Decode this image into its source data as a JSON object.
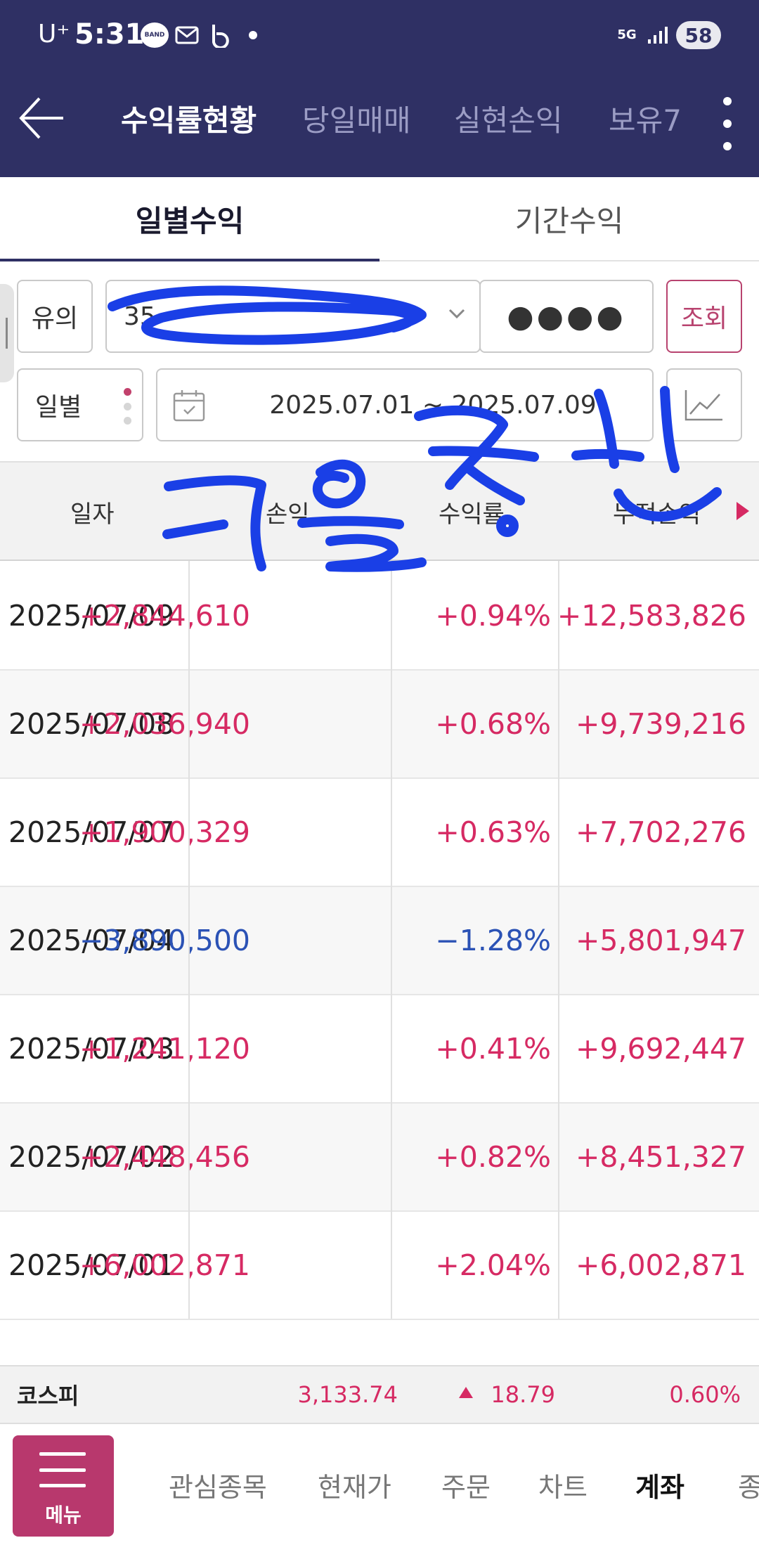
{
  "status_bar": {
    "carrier": "U⁺",
    "time": "5:31",
    "band_label": "BAND",
    "network": "5G",
    "battery": "58"
  },
  "header": {
    "tabs": [
      "수익률현황",
      "당일매매",
      "실현손익",
      "보유7"
    ],
    "active_tab": 0
  },
  "subtabs": [
    "일별수익",
    "기간수익"
  ],
  "controls": {
    "account_type": "유의",
    "account_number": "35",
    "password_mask": "●●●●",
    "query_label": "조회",
    "period_type": "일별",
    "date_range": "2025.07.01 ~ 2025.07.09"
  },
  "table": {
    "headers": [
      "일자",
      "손익",
      "수익률",
      "누적손익"
    ],
    "rows": [
      {
        "date": "2025/07/09",
        "pl": "+2,844,610",
        "rate": "+0.94%",
        "cum": "+12,583,826",
        "pl_sign": "pos",
        "rate_sign": "pos"
      },
      {
        "date": "2025/07/08",
        "pl": "+2,036,940",
        "rate": "+0.68%",
        "cum": "+9,739,216",
        "pl_sign": "pos",
        "rate_sign": "pos"
      },
      {
        "date": "2025/07/07",
        "pl": "+1,900,329",
        "rate": "+0.63%",
        "cum": "+7,702,276",
        "pl_sign": "pos",
        "rate_sign": "pos"
      },
      {
        "date": "2025/07/04",
        "pl": "−3,890,500",
        "rate": "−1.28%",
        "cum": "+5,801,947",
        "pl_sign": "neg",
        "rate_sign": "neg"
      },
      {
        "date": "2025/07/03",
        "pl": "+1,241,120",
        "rate": "+0.41%",
        "cum": "+9,692,447",
        "pl_sign": "pos",
        "rate_sign": "pos"
      },
      {
        "date": "2025/07/02",
        "pl": "+2,448,456",
        "rate": "+0.82%",
        "cum": "+8,451,327",
        "pl_sign": "pos",
        "rate_sign": "pos"
      },
      {
        "date": "2025/07/01",
        "pl": "+6,002,871",
        "rate": "+2.04%",
        "cum": "+6,002,871",
        "pl_sign": "pos",
        "rate_sign": "pos"
      }
    ]
  },
  "kospi": {
    "name": "코스피",
    "value": "3,133.74",
    "change": "18.79",
    "change_pct": "0.60%"
  },
  "bottom_nav": {
    "menu_label": "메뉴",
    "items": [
      "관심종목",
      "현재가",
      "주문",
      "차트",
      "계좌",
      "종"
    ],
    "active_item": "계좌"
  },
  "colors": {
    "header_bg": "#2f3064",
    "positive": "#d62a63",
    "negative": "#2b52b5",
    "accent": "#b8386d",
    "scribble": "#1a3fe6"
  }
}
